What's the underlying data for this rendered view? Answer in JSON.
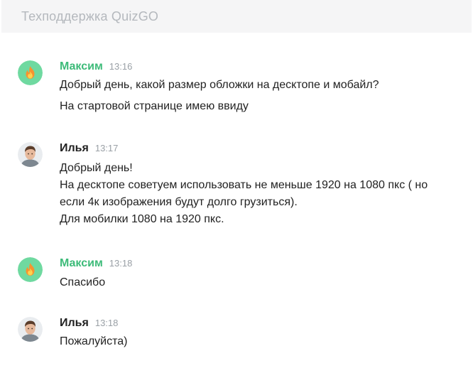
{
  "header": {
    "title": "Техподдержка QuizGO"
  },
  "colors": {
    "header_bg": "#f5f5f6",
    "accent_green": "#3dbb79",
    "avatar_green": "#6fd9a0",
    "timestamp": "#9aa0a6"
  },
  "messages": [
    {
      "author": "Максим",
      "time": "13:16",
      "avatar_icon": "fire-icon",
      "lines": [
        "Добрый день, какой размер обложки на десктопе и мобайл?",
        "На стартовой странице имею ввиду"
      ]
    },
    {
      "author": "Илья",
      "time": "13:17",
      "avatar_icon": "user-photo",
      "lines": [
        "Добрый день!",
        "На десктопе советуем использовать не меньше 1920 на 1080 пкс ( но",
        "если 4к изображения будут долго грузиться).",
        "Для мобилки 1080 на 1920 пкс."
      ]
    },
    {
      "author": "Максим",
      "time": "13:18",
      "avatar_icon": "fire-icon",
      "lines": [
        "Спасибо"
      ]
    },
    {
      "author": "Илья",
      "time": "13:18",
      "avatar_icon": "user-photo",
      "lines": [
        "Пожалуйста)"
      ]
    }
  ]
}
